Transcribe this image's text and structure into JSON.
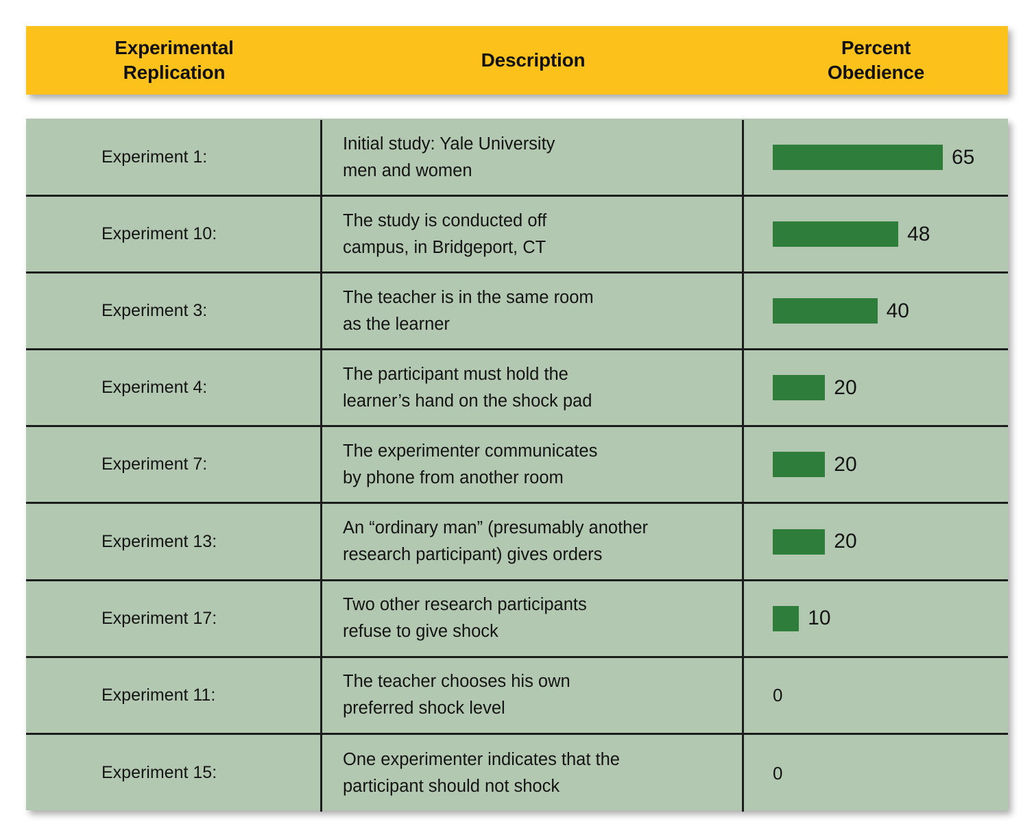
{
  "header": {
    "col1": "Experimental\nReplication",
    "col2": "Description",
    "col3": "Percent\nObedience"
  },
  "colors": {
    "header_band": "#fcc21b",
    "cell_background": "#b3c8b0",
    "bar_fill": "#2e7d3a",
    "grid_line": "#1c1c1c",
    "text": "#141414"
  },
  "chart_data": {
    "type": "bar",
    "title": "",
    "xlabel": "Percent Obedience",
    "ylabel": "Experimental Replication",
    "xlim": [
      0,
      65
    ],
    "grid": false,
    "legend": "none",
    "orientation": "horizontal",
    "categories": [
      "Experiment 1:",
      "Experiment 10:",
      "Experiment 3:",
      "Experiment 4:",
      "Experiment 7:",
      "Experiment 13:",
      "Experiment 17:",
      "Experiment 11:",
      "Experiment 15:"
    ],
    "values": [
      65,
      48,
      40,
      20,
      20,
      20,
      10,
      0,
      0
    ],
    "descriptions": [
      "Initial study: Yale University\nmen and women",
      "The study is conducted off\ncampus, in Bridgeport, CT",
      "The teacher is in the same room\nas the learner",
      "The participant must hold the\nlearner’s hand on the shock pad",
      "The experimenter communicates\nby phone from another room",
      "An “ordinary man” (presumably another\nresearch participant) gives orders",
      "Two other research participants\nrefuse to give shock",
      "The teacher chooses his own\npreferred shock level",
      "One experimenter indicates that the\nparticipant should not shock"
    ]
  },
  "rows": [
    {
      "label": "Experiment 1:",
      "description": "Initial study: Yale University\nmen and women",
      "value": 65,
      "value_label": "65"
    },
    {
      "label": "Experiment 10:",
      "description": "The study is conducted off\ncampus, in Bridgeport, CT",
      "value": 48,
      "value_label": "48"
    },
    {
      "label": "Experiment 3:",
      "description": "The teacher is in the same room\nas the learner",
      "value": 40,
      "value_label": "40"
    },
    {
      "label": "Experiment 4:",
      "description": "The participant must hold the\nlearner’s hand on the shock pad",
      "value": 20,
      "value_label": "20"
    },
    {
      "label": "Experiment 7:",
      "description": "The experimenter communicates\nby phone from another room",
      "value": 20,
      "value_label": "20"
    },
    {
      "label": "Experiment 13:",
      "description": "An “ordinary man” (presumably another\nresearch participant) gives orders",
      "value": 20,
      "value_label": "20"
    },
    {
      "label": "Experiment 17:",
      "description": "Two other research participants\nrefuse to give shock",
      "value": 10,
      "value_label": "10"
    },
    {
      "label": "Experiment 11:",
      "description": "The teacher chooses his own\npreferred shock level",
      "value": 0,
      "value_label": "0"
    },
    {
      "label": "Experiment 15:",
      "description": "One experimenter indicates that the\nparticipant should not shock",
      "value": 0,
      "value_label": "0"
    }
  ]
}
